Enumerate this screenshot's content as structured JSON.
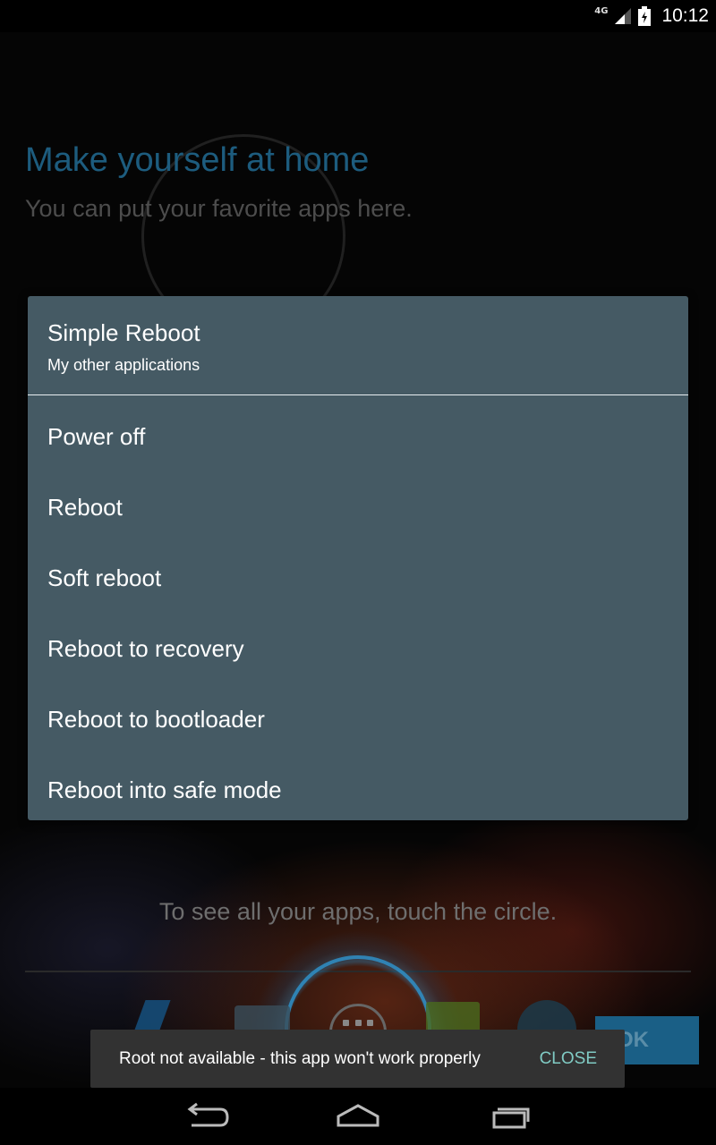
{
  "status_bar": {
    "network": "4G",
    "time": "10:12",
    "icons": [
      "signal-icon",
      "battery-icon"
    ]
  },
  "launcher": {
    "cling_title": "Make yourself at home",
    "cling_subtitle": "You can put your favorite apps here.",
    "cling_hint": "To see all your apps, touch the circle.",
    "ok_label": "OK"
  },
  "dialog": {
    "title": "Simple Reboot",
    "subtitle": "My other applications",
    "items": [
      {
        "label": "Power off"
      },
      {
        "label": "Reboot"
      },
      {
        "label": "Soft reboot"
      },
      {
        "label": "Reboot to recovery"
      },
      {
        "label": "Reboot to bootloader"
      },
      {
        "label": "Reboot into safe mode"
      }
    ]
  },
  "snackbar": {
    "message": "Root not available - this app won't work properly",
    "action": "CLOSE"
  },
  "nav_bar": {
    "icons": [
      "back-icon",
      "home-icon",
      "recents-icon"
    ]
  },
  "colors": {
    "dialog_background": "#455a64",
    "cling_title": "#1d5c7e",
    "snackbar_action": "#80cbc4",
    "snackbar_background": "#323232"
  }
}
